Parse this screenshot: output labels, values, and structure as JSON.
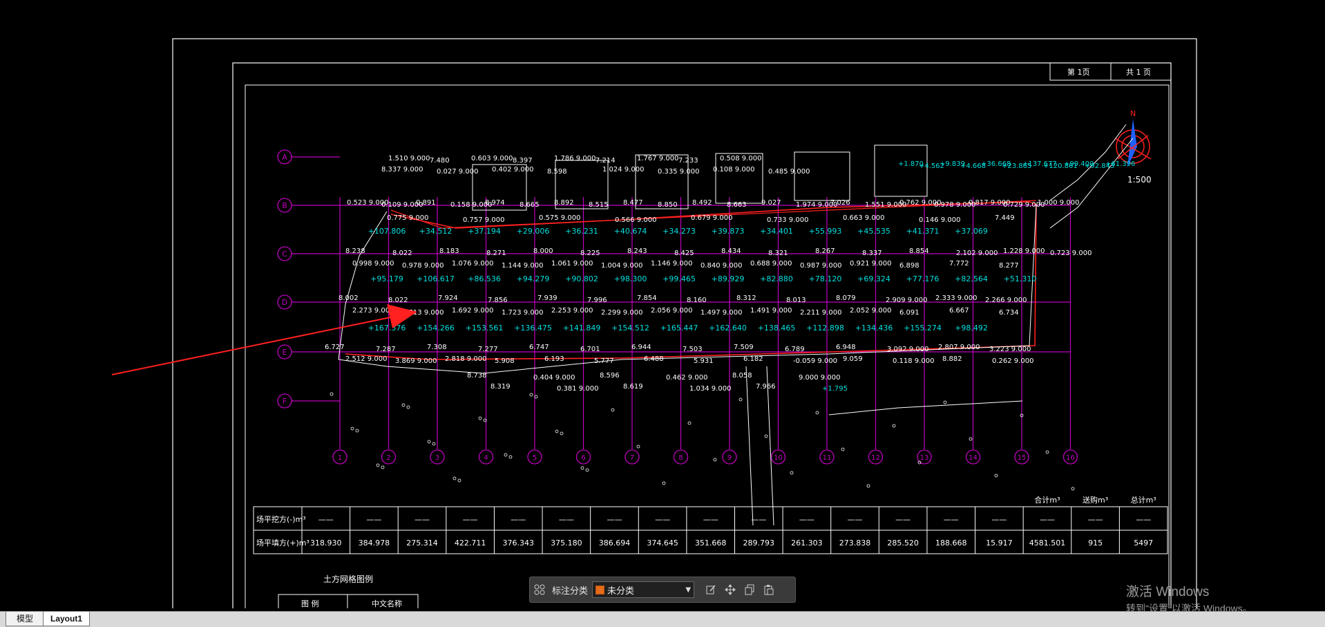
{
  "drawing": {
    "sheet_header": [
      "第 1页",
      "共 1 页"
    ],
    "scale_label": "1:500",
    "north_label": "N",
    "row_labels": [
      "A",
      "B",
      "C",
      "D",
      "E",
      "F"
    ],
    "col_labels": [
      "1",
      "2",
      "3",
      "4",
      "5",
      "6",
      "7",
      "8",
      "9",
      "10",
      "11",
      "12",
      "13",
      "14",
      "15",
      "16"
    ],
    "row1_cyan": [
      "+107.806",
      "+34.512",
      "+37.194",
      "+29.006",
      "+36.231",
      "+40.674",
      "+34.273",
      "+39.873",
      "+34.401",
      "+55.993",
      "+45.535",
      "+41.371",
      "+37.069"
    ],
    "row2_cyan": [
      "+95.179",
      "+106.617",
      "+86.536",
      "+94.279",
      "+90.802",
      "+98.300",
      "+99.465",
      "+89.929",
      "+82.880",
      "+78.120",
      "+69.324",
      "+77.176",
      "+82.564",
      "+51.310"
    ],
    "row3_cyan": [
      "+167.376",
      "+154.266",
      "+153.561",
      "+136.475",
      "+141.849",
      "+154.512",
      "+165.447",
      "+162.640",
      "+138.465",
      "+112.898",
      "+134.436",
      "+155.274",
      "+98.492"
    ],
    "grid_text": [
      {
        "t": "1.510 9.000"
      },
      {
        "t": "7.480"
      },
      {
        "t": "0.603 9.000"
      },
      {
        "t": "8.397"
      },
      {
        "t": "1.786 9.000"
      },
      {
        "t": "7.214"
      },
      {
        "t": "1.767 9.000"
      },
      {
        "t": "7.233"
      },
      {
        "t": "0.508 9.000"
      },
      {
        "t": "8.337 9.000"
      },
      {
        "t": "0.027 9.000"
      },
      {
        "t": "0.402 9.000"
      },
      {
        "t": "8.598"
      },
      {
        "t": "1.024 9.000"
      },
      {
        "t": "0.335 9.000"
      },
      {
        "t": "0.108 9.000"
      },
      {
        "t": "0.485 9.000"
      },
      {
        "t": "0.523 9.000"
      },
      {
        "t": "0.109 9.000"
      },
      {
        "t": "0.891"
      },
      {
        "t": "0.158 9.000"
      },
      {
        "t": "8.974"
      },
      {
        "t": "8.665"
      },
      {
        "t": "8.892"
      },
      {
        "t": "8.515"
      },
      {
        "t": "8.477"
      },
      {
        "t": "8.850"
      },
      {
        "t": "8.492"
      },
      {
        "t": "8.663"
      },
      {
        "t": "9.027"
      },
      {
        "t": "1.974 9.000"
      },
      {
        "t": "7.026"
      },
      {
        "t": "1.551 9.000"
      },
      {
        "t": "0.762 9.000"
      },
      {
        "t": "0.978 9.000"
      },
      {
        "t": "0.817 9.000"
      },
      {
        "t": "0.729 9.000"
      },
      {
        "t": "1.000 9.000"
      },
      {
        "t": "0.775 9.000"
      },
      {
        "t": "0.757 9.000"
      },
      {
        "t": "0.575 9.000"
      },
      {
        "t": "0.566 9.000"
      },
      {
        "t": "0.679 9.000"
      },
      {
        "t": "0.733 9.000"
      },
      {
        "t": "0.663 9.000"
      },
      {
        "t": "0.146 9.000"
      },
      {
        "t": "7.449"
      },
      {
        "t": "8.238"
      },
      {
        "t": "8.022"
      },
      {
        "t": "8.183"
      },
      {
        "t": "8.271"
      },
      {
        "t": "8.000"
      },
      {
        "t": "8.225"
      },
      {
        "t": "8.243"
      },
      {
        "t": "8.425"
      },
      {
        "t": "8.434"
      },
      {
        "t": "8.321"
      },
      {
        "t": "8.267"
      },
      {
        "t": "8.337"
      },
      {
        "t": "8.854"
      },
      {
        "t": "2.102 9.000"
      },
      {
        "t": "1.228 9.000"
      },
      {
        "t": "0.723 9.000"
      },
      {
        "t": "0.998 9.000"
      },
      {
        "t": "0.978 9.000"
      },
      {
        "t": "1.076 9.000"
      },
      {
        "t": "1.144 9.000"
      },
      {
        "t": "1.061 9.000"
      },
      {
        "t": "1.004 9.000"
      },
      {
        "t": "1.146 9.000"
      },
      {
        "t": "0.840 9.000"
      },
      {
        "t": "0.688 9.000"
      },
      {
        "t": "0.987 9.000"
      },
      {
        "t": "0.921 9.000"
      },
      {
        "t": "6.898"
      },
      {
        "t": "7.772"
      },
      {
        "t": "8.277"
      },
      {
        "t": "8.002"
      },
      {
        "t": "8.022"
      },
      {
        "t": "7.924"
      },
      {
        "t": "7.856"
      },
      {
        "t": "7.939"
      },
      {
        "t": "7.996"
      },
      {
        "t": "7.854"
      },
      {
        "t": "8.160"
      },
      {
        "t": "8.312"
      },
      {
        "t": "8.013"
      },
      {
        "t": "8.079"
      },
      {
        "t": "2.909 9.000"
      },
      {
        "t": "2.333 9.000"
      },
      {
        "t": "2.266 9.000"
      },
      {
        "t": "2.273 9.000"
      },
      {
        "t": "1.713 9.000"
      },
      {
        "t": "1.692 9.000"
      },
      {
        "t": "1.723 9.000"
      },
      {
        "t": "2.253 9.000"
      },
      {
        "t": "2.299 9.000"
      },
      {
        "t": "2.056 9.000"
      },
      {
        "t": "1.497 9.000"
      },
      {
        "t": "1.491 9.000"
      },
      {
        "t": "2.211 9.000"
      },
      {
        "t": "2.052 9.000"
      },
      {
        "t": "6.091"
      },
      {
        "t": "6.667"
      },
      {
        "t": "6.734"
      },
      {
        "t": "6.727"
      },
      {
        "t": "7.287"
      },
      {
        "t": "7.308"
      },
      {
        "t": "7.277"
      },
      {
        "t": "6.747"
      },
      {
        "t": "6.701"
      },
      {
        "t": "6.944"
      },
      {
        "t": "7.503"
      },
      {
        "t": "7.509"
      },
      {
        "t": "6.789"
      },
      {
        "t": "6.948"
      },
      {
        "t": "3.092 9.000"
      },
      {
        "t": "2.807 9.000"
      },
      {
        "t": "3.223 9.000"
      },
      {
        "t": "2.512 9.000"
      },
      {
        "t": "3.869 9.000"
      },
      {
        "t": "2.818 9.000"
      },
      {
        "t": "5.908"
      },
      {
        "t": "6.193"
      },
      {
        "t": "5.777"
      },
      {
        "t": "6.488"
      },
      {
        "t": "5.931"
      },
      {
        "t": "6.182"
      },
      {
        "t": "-0.059 9.000"
      },
      {
        "t": "9.059"
      },
      {
        "t": "0.118 9.000"
      },
      {
        "t": "8.882"
      },
      {
        "t": "0.262 9.000"
      },
      {
        "t": "8.738"
      },
      {
        "t": "0.404 9.000"
      },
      {
        "t": "8.596"
      },
      {
        "t": "0.462 9.000"
      },
      {
        "t": "8.058"
      },
      {
        "t": "9.000 9.000"
      },
      {
        "t": "8.319"
      },
      {
        "t": "0.381 9.000"
      },
      {
        "t": "8.619"
      },
      {
        "t": "1.034 9.000"
      },
      {
        "t": "7.966"
      },
      {
        "t": "+1.795"
      },
      {
        "t": "+1.870"
      },
      {
        "t": "+4.562"
      },
      {
        "t": "+9.839"
      },
      {
        "t": "+4.668"
      },
      {
        "t": "+36.668"
      },
      {
        "t": "+23.865"
      },
      {
        "t": "+137.677"
      },
      {
        "t": "+120.861"
      },
      {
        "t": "+99.400"
      },
      {
        "t": "+92.843"
      },
      {
        "t": "+61.396"
      }
    ],
    "table": {
      "row1_label": "场平挖方(-)m³",
      "row2_label": "场平填方(+)m³",
      "row1_values": [
        "——",
        "——",
        "——",
        "——",
        "——",
        "——",
        "——",
        "——",
        "——",
        "——",
        "——",
        "——",
        "——",
        "——",
        "——",
        "——",
        "——",
        "——"
      ],
      "row2_values": [
        "318.930",
        "384.978",
        "275.314",
        "422.711",
        "376.343",
        "375.180",
        "386.694",
        "374.645",
        "351.668",
        "289.793",
        "261.303",
        "273.838",
        "285.520",
        "188.668",
        "15.917",
        "4581.501",
        "915",
        "5497"
      ],
      "top_headers": [
        "合计m³",
        "送购m³",
        "总计m³"
      ],
      "legend_title": "土方网格图例",
      "legend_headers": [
        "图 例",
        "中文名称"
      ]
    }
  },
  "toolbar": {
    "label": "标注分类",
    "select_value": "未分类",
    "swatch_color": "#e46c1a",
    "icons": [
      "grid-icon",
      "edit-icon",
      "move-icon",
      "copy-icon",
      "paste-icon"
    ]
  },
  "tabs": [
    "模型",
    "Layout1"
  ],
  "watermark": {
    "line1": "激活 Windows",
    "line2": "转到\"设置\"以激活 Windows。"
  },
  "colors": {
    "background": "#000000",
    "frame": "#ffffff",
    "grid": "#c000c0",
    "cyan": "#00e0e0",
    "red": "#ff2020",
    "blue": "#1e60ff"
  }
}
